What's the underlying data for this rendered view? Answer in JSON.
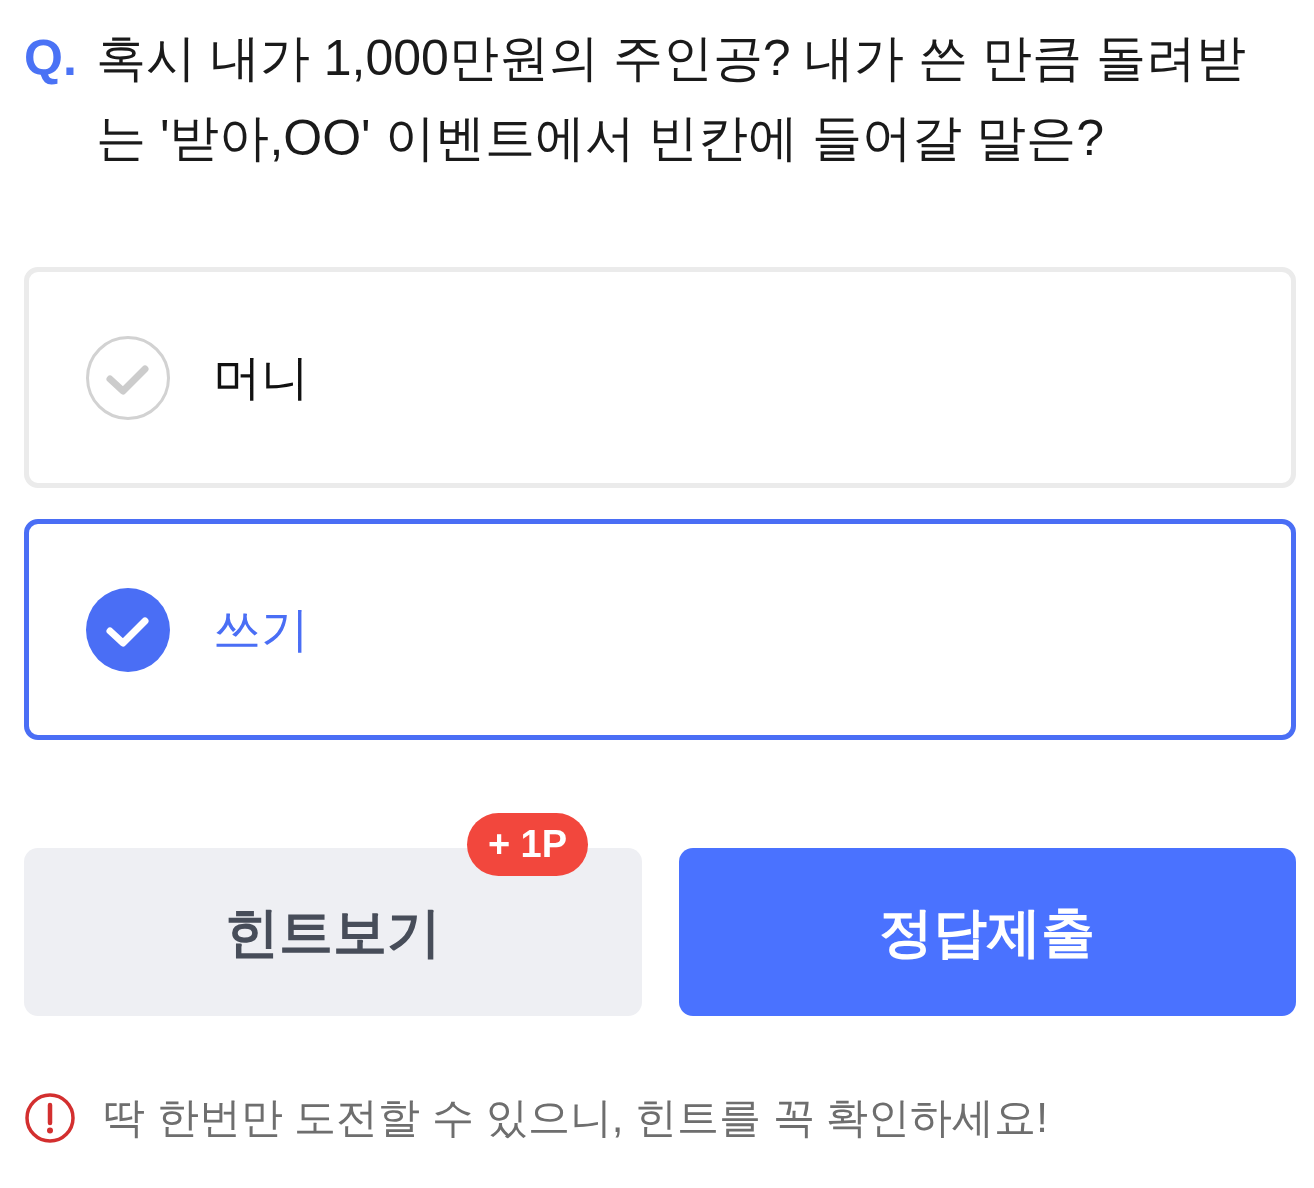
{
  "question": {
    "marker": "Q.",
    "text": "혹시 내가 1,000만원의 주인공? 내가 쓴 만큼 돌려받는 '받아,OO' 이벤트에서 빈칸에 들어갈 말은?"
  },
  "options": [
    {
      "label": "머니",
      "selected": false
    },
    {
      "label": "쓰기",
      "selected": true
    }
  ],
  "buttons": [
    {
      "kind": "hint",
      "label": "힌트보기",
      "badge": "+ 1P"
    },
    {
      "kind": "submit",
      "label": "정답제출"
    }
  ],
  "notice": {
    "text": "딱 한번만 도전할 수 있으니, 힌트를 꼭 확인하세요!"
  }
}
